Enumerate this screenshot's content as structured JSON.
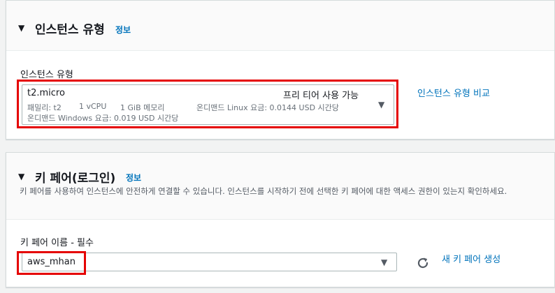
{
  "instance_type_section": {
    "title": "인스턴스 유형",
    "info_link": "정보",
    "field_label": "인스턴스 유형",
    "selected": {
      "name": "t2.micro",
      "badge": "프리 티어 사용 가능",
      "family": "패밀리: t2",
      "vcpu": "1 vCPU",
      "memory": "1 GiB 메모리",
      "linux_price": "온디맨드 Linux 요금: 0.0144 USD 시간당",
      "windows_price": "온디맨드 Windows 요금: 0.019 USD 시간당"
    },
    "compare_link": "인스턴스 유형 비교"
  },
  "key_pair_section": {
    "title": "키 페어(로그인)",
    "info_link": "정보",
    "description": "키 페어를 사용하여 인스턴스에 안전하게 연결할 수 있습니다. 인스턴스를 시작하기 전에 선택한 키 페어에 대한 액세스 권한이 있는지 확인하세요.",
    "field_label": "키 페어 이름 - 필수",
    "selected_value": "aws_mhan",
    "create_link": "새 키 페어 생성"
  },
  "icons": {
    "collapse": "caret-down-icon",
    "dropdown": "dropdown-arrow-icon",
    "refresh": "refresh-icon"
  },
  "colors": {
    "link": "#0073bb",
    "highlight": "#e50000",
    "background": "#f2f3f3"
  }
}
